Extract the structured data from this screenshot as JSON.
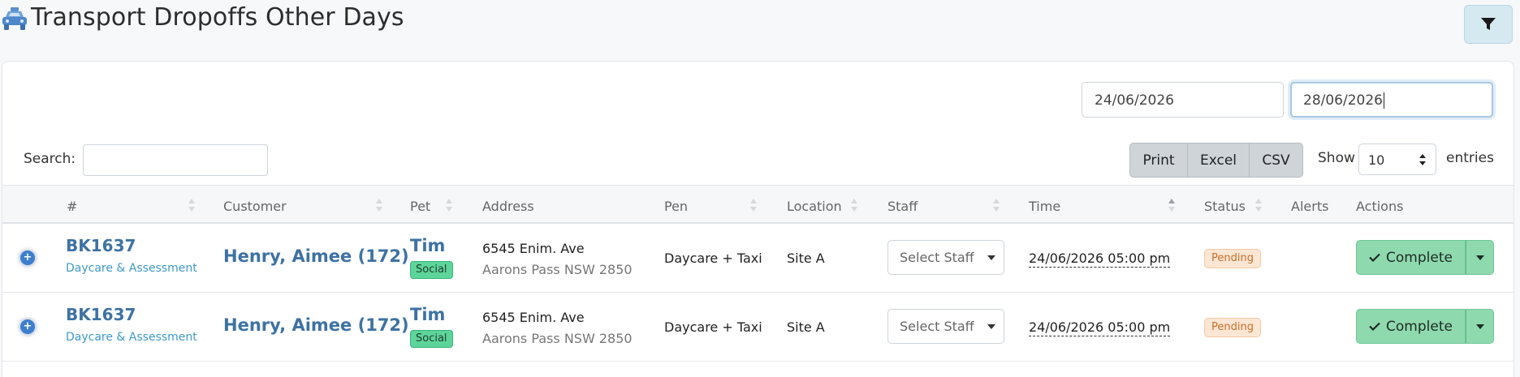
{
  "page": {
    "title": "Transport Dropoffs Other Days",
    "icon": "taxi-icon"
  },
  "filter_button": {
    "icon": "filter-icon"
  },
  "date_range": {
    "from": "24/06/2026",
    "to": "28/06/2026"
  },
  "search": {
    "label": "Search:",
    "value": ""
  },
  "export_buttons": {
    "print": "Print",
    "excel": "Excel",
    "csv": "CSV"
  },
  "length": {
    "show": "Show",
    "value": "10",
    "entries": "entries"
  },
  "table": {
    "headers": {
      "num": "#",
      "customer": "Customer",
      "pet": "Pet",
      "address": "Address",
      "pen": "Pen",
      "location": "Location",
      "staff": "Staff",
      "time": "Time",
      "status": "Status",
      "alerts": "Alerts",
      "actions": "Actions"
    },
    "rows": [
      {
        "booking_id": "BK1637",
        "booking_type": "Daycare & Assessment",
        "customer": "Henry, Aimee (172)",
        "pet": "Tim",
        "pet_tag": "Social",
        "address_line1": "6545 Enim. Ave",
        "address_line2": "Aarons Pass NSW 2850",
        "pen": "Daycare + Taxi",
        "location": "Site A",
        "staff_placeholder": "Select Staff",
        "time": "24/06/2026 05:00 pm",
        "status": "Pending",
        "action": "Complete"
      },
      {
        "booking_id": "BK1637",
        "booking_type": "Daycare & Assessment",
        "customer": "Henry, Aimee (172)",
        "pet": "Tim",
        "pet_tag": "Social",
        "address_line1": "6545 Enim. Ave",
        "address_line2": "Aarons Pass NSW 2850",
        "pen": "Daycare + Taxi",
        "location": "Site A",
        "staff_placeholder": "Select Staff",
        "time": "24/06/2026 05:00 pm",
        "status": "Pending",
        "action": "Complete"
      }
    ]
  },
  "colors": {
    "link": "#3e72a3",
    "success": "#8fd9ae",
    "pending_bg": "#fde6d3",
    "pending_text": "#c86f2c",
    "tag_green": "#5dd59a"
  }
}
